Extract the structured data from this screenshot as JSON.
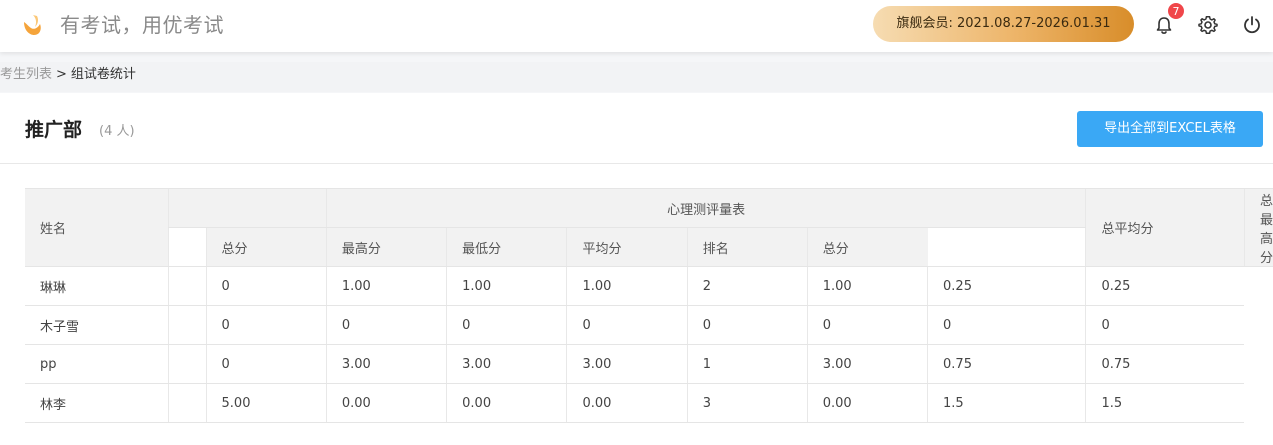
{
  "header": {
    "slogan": "有考试，用优考试",
    "vip_label": "旗舰会员: 2021.08.27-2026.01.31",
    "notification_count": "7",
    "icons": [
      "logo-icon",
      "bell-icon",
      "gear-icon",
      "power-icon"
    ],
    "colors": {
      "vip_from": "#f6dcb2",
      "vip_to": "#d88d2a",
      "badge": "#f0464a",
      "primary": "#3aa8f5"
    }
  },
  "breadcrumb": {
    "parent": "考生列表",
    "separator": ">",
    "current": "组试卷统计"
  },
  "panel": {
    "department": "推广部",
    "member_count": "(4 人)",
    "export_label": "导出全部到EXCEL表格"
  },
  "table": {
    "col_name": "姓名",
    "group_title": "心理测评量表",
    "col_total_avg": "总平均分",
    "col_total_max": "总最高分",
    "sub_headers": [
      "总分",
      "最高分",
      "最低分",
      "平均分",
      "排名",
      "总分"
    ],
    "rows": [
      {
        "name": "琳琳",
        "cells": [
          "0",
          "1.00",
          "1.00",
          "1.00",
          "2",
          "1.00"
        ],
        "total_avg": "0.25",
        "total_max": "0.25"
      },
      {
        "name": "木子雪",
        "cells": [
          "0",
          "0",
          "0",
          "0",
          "0",
          "0"
        ],
        "total_avg": "0",
        "total_max": "0"
      },
      {
        "name": "pp",
        "cells": [
          "0",
          "3.00",
          "3.00",
          "3.00",
          "1",
          "3.00"
        ],
        "total_avg": "0.75",
        "total_max": "0.75"
      },
      {
        "name": "林李",
        "cells": [
          "5.00",
          "0.00",
          "0.00",
          "0.00",
          "3",
          "0.00"
        ],
        "total_avg": "1.5",
        "total_max": "1.5"
      }
    ]
  }
}
